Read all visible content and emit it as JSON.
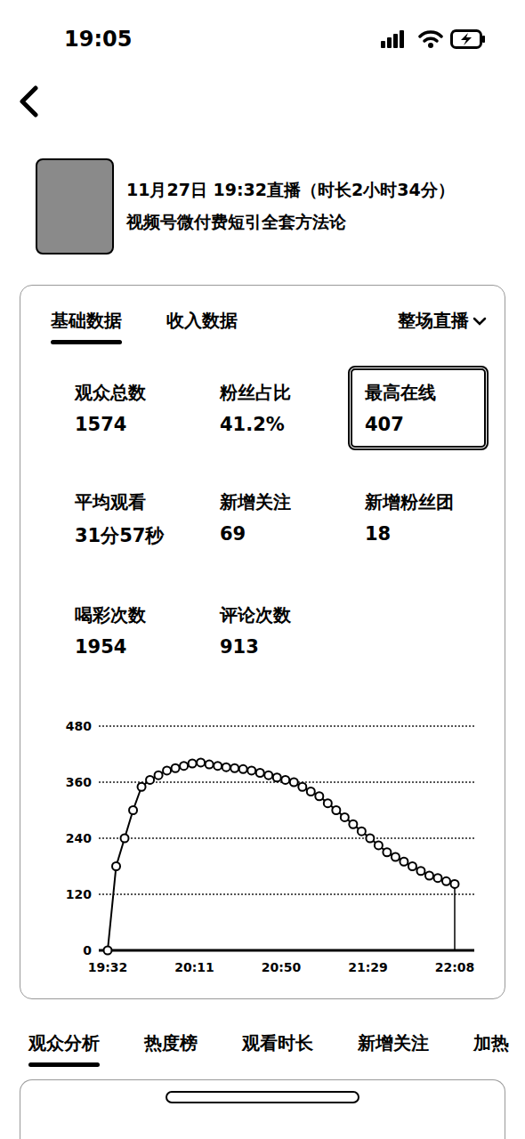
{
  "status_bar": {
    "time": "19:05"
  },
  "header": {
    "title": "11月27日 19:32直播（时长2小时34分）",
    "subtitle": "视频号微付费短引全套方法论"
  },
  "card": {
    "tabs": [
      {
        "label": "基础数据",
        "selected": true
      },
      {
        "label": "收入数据",
        "selected": false
      }
    ],
    "range": "整场直播"
  },
  "metrics": [
    {
      "label": "观众总数",
      "value": "1574",
      "selected": false
    },
    {
      "label": "粉丝占比",
      "value": "41.2%",
      "selected": false
    },
    {
      "label": "最高在线",
      "value": "407",
      "selected": true
    },
    {
      "label": "平均观看",
      "value": "31分57秒",
      "selected": false
    },
    {
      "label": "新增关注",
      "value": "69",
      "selected": false
    },
    {
      "label": "新增粉丝团",
      "value": "18",
      "selected": false
    },
    {
      "label": "喝彩次数",
      "value": "1954",
      "selected": false
    },
    {
      "label": "评论次数",
      "value": "913",
      "selected": false
    }
  ],
  "chart": {
    "y_ticks": [
      "480",
      "360",
      "240",
      "120",
      "0"
    ],
    "x_ticks": [
      "19:32",
      "20:11",
      "20:50",
      "21:29",
      "22:08"
    ],
    "series": [
      {
        "values": [
          0,
          180,
          240,
          300,
          350,
          365,
          375,
          385,
          390,
          395,
          400,
          402,
          398,
          395,
          392,
          390,
          388,
          385,
          380,
          375,
          370,
          365,
          360,
          350,
          340,
          330,
          315,
          300,
          285,
          270,
          255,
          240,
          225,
          210,
          200,
          190,
          180,
          170,
          160,
          155,
          148,
          142
        ]
      }
    ],
    "cursor_index": 41
  },
  "bottom_tabs": [
    {
      "label": "观众分析",
      "selected": true
    },
    {
      "label": "热度榜",
      "selected": false
    },
    {
      "label": "观看时长",
      "selected": false
    },
    {
      "label": "新增关注",
      "selected": false
    },
    {
      "label": "加热",
      "selected": false
    }
  ]
}
